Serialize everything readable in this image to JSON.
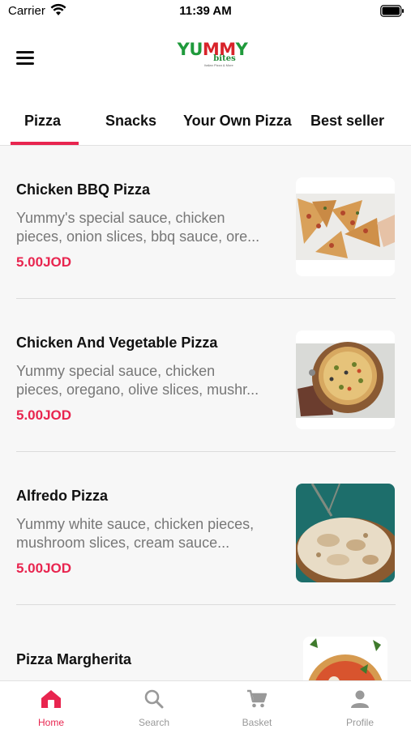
{
  "status_bar": {
    "carrier": "Carrier",
    "time": "11:39 AM"
  },
  "header": {
    "logo": {
      "main_part1": "YU",
      "main_part2": "MM",
      "main_part3": "Y",
      "sub": "bites",
      "tagline": "Italian Pizza & More"
    }
  },
  "tabs": [
    {
      "label": "Pizza",
      "active": true
    },
    {
      "label": "Snacks",
      "active": false
    },
    {
      "label": "Your Own Pizza",
      "active": false
    },
    {
      "label": "Best seller",
      "active": false
    }
  ],
  "items": [
    {
      "name": "Chicken BBQ Pizza",
      "desc_line1": "Yummy's special sauce, chicken",
      "desc_line2": "pieces, onion slices, bbq sauce, ore...",
      "price": "5.00JOD"
    },
    {
      "name": "Chicken And Vegetable Pizza",
      "desc_line1": "Yummy special sauce, chicken",
      "desc_line2": "pieces, oregano, olive slices, mushr...",
      "price": "5.00JOD"
    },
    {
      "name": "Alfredo Pizza",
      "desc_line1": "Yummy white sauce, chicken pieces,",
      "desc_line2": "mushroom slices, cream sauce...",
      "price": "5.00JOD"
    },
    {
      "name": "Pizza Margherita",
      "desc_line1": "",
      "desc_line2": "",
      "price": ""
    }
  ],
  "bottom_nav": [
    {
      "label": "Home",
      "icon": "home-icon",
      "active": true
    },
    {
      "label": "Search",
      "icon": "search-icon",
      "active": false
    },
    {
      "label": "Basket",
      "icon": "cart-icon",
      "active": false
    },
    {
      "label": "Profile",
      "icon": "person-icon",
      "active": false
    }
  ],
  "colors": {
    "accent": "#e8254f",
    "logo_green": "#1f9a3b",
    "logo_red": "#d8232a",
    "inactive": "#999999"
  }
}
